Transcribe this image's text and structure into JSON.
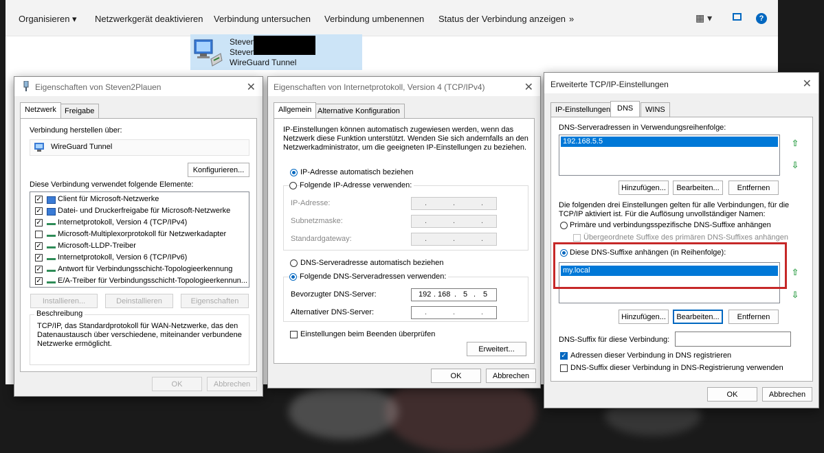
{
  "explorer": {
    "commands": [
      "Organisieren",
      "Netzwerkgerät deaktivieren",
      "Verbindung untersuchen",
      "Verbindung umbenennen",
      "Status der Verbindung anzeigen",
      "»"
    ],
    "network_item": {
      "line1": "Steven",
      "line2": "Steven",
      "line3": "WireGuard Tunnel"
    }
  },
  "dialog1": {
    "title": "Eigenschaften von Steven2Plauen",
    "tabs": [
      "Netzwerk",
      "Freigabe"
    ],
    "connect_via_label": "Verbindung herstellen über:",
    "adapter_name": "WireGuard Tunnel",
    "configure_btn": "Konfigurieren...",
    "items_label": "Diese Verbindung verwendet folgende Elemente:",
    "items": [
      {
        "label": "Client für Microsoft-Netzwerke",
        "checked": true
      },
      {
        "label": "Datei- und Druckerfreigabe für Microsoft-Netzwerke",
        "checked": true
      },
      {
        "label": "Internetprotokoll, Version 4 (TCP/IPv4)",
        "checked": true
      },
      {
        "label": "Microsoft-Multiplexorprotokoll für Netzwerkadapter",
        "checked": false
      },
      {
        "label": "Microsoft-LLDP-Treiber",
        "checked": true
      },
      {
        "label": "Internetprotokoll, Version 6 (TCP/IPv6)",
        "checked": true
      },
      {
        "label": "Antwort für Verbindungsschicht-Topologieerkennung",
        "checked": true
      },
      {
        "label": "E/A-Treiber für Verbindungsschicht-Topologieerkennun...",
        "checked": true
      }
    ],
    "install_btn": "Installieren...",
    "uninstall_btn": "Deinstallieren",
    "properties_btn": "Eigenschaften",
    "description_legend": "Beschreibung",
    "description_text": "TCP/IP, das Standardprotokoll für WAN-Netzwerke, das den Datenaustausch über verschiedene, miteinander verbundene Netzwerke ermöglicht.",
    "ok_btn": "OK",
    "cancel_btn": "Abbrechen"
  },
  "dialog2": {
    "title": "Eigenschaften von Internetprotokoll, Version 4 (TCP/IPv4)",
    "tabs": [
      "Allgemein",
      "Alternative Konfiguration"
    ],
    "intro": "IP-Einstellungen können automatisch zugewiesen werden, wenn das Netzwerk diese Funktion unterstützt. Wenden Sie sich andernfalls an den Netzwerkadministrator, um die geeigneten IP-Einstellungen zu beziehen.",
    "ip_auto": "IP-Adresse automatisch beziehen",
    "ip_manual": "Folgende IP-Adresse verwenden:",
    "ip_address_label": "IP-Adresse:",
    "subnet_label": "Subnetzmaske:",
    "gateway_label": "Standardgateway:",
    "dns_auto": "DNS-Serveradresse automatisch beziehen",
    "dns_manual": "Folgende DNS-Serveradressen verwenden:",
    "preferred_dns_label": "Bevorzugter DNS-Server:",
    "preferred_dns_octets": [
      "192",
      "168",
      "5",
      "5"
    ],
    "alternate_dns_label": "Alternativer DNS-Server:",
    "validate_label": "Einstellungen beim Beenden überprüfen",
    "advanced_btn": "Erweitert...",
    "ok_btn": "OK",
    "cancel_btn": "Abbrechen"
  },
  "dialog3": {
    "title": "Erweiterte TCP/IP-Einstellungen",
    "tabs": [
      "IP-Einstellungen",
      "DNS",
      "WINS"
    ],
    "dns_servers_label": "DNS-Serveradressen in Verwendungsreihenfolge:",
    "dns_servers": [
      "192.168.5.5"
    ],
    "add_btn": "Hinzufügen...",
    "edit_btn": "Bearbeiten...",
    "remove_btn": "Entfernen",
    "info_text_1": "Die folgenden drei Einstellungen gelten für alle Verbindungen, für die",
    "info_text_2": "TCP/IP aktiviert ist. Für die Auflösung unvollständiger Namen:",
    "primary_suffix": "Primäre und verbindungsspezifische DNS-Suffixe anhängen",
    "parent_suffix": "Übergeordnete Suffixe des primären DNS-Suffixes anhängen",
    "append_suffixes": "Diese DNS-Suffixe anhängen (in Reihenfolge):",
    "suffixes": [
      "my.local"
    ],
    "conn_suffix_label": "DNS-Suffix für diese Verbindung:",
    "register_label": "Adressen dieser Verbindung in DNS registrieren",
    "use_suffix_label": "DNS-Suffix dieser Verbindung in DNS-Registrierung verwenden",
    "ok_btn": "OK",
    "cancel_btn": "Abbrechen"
  }
}
